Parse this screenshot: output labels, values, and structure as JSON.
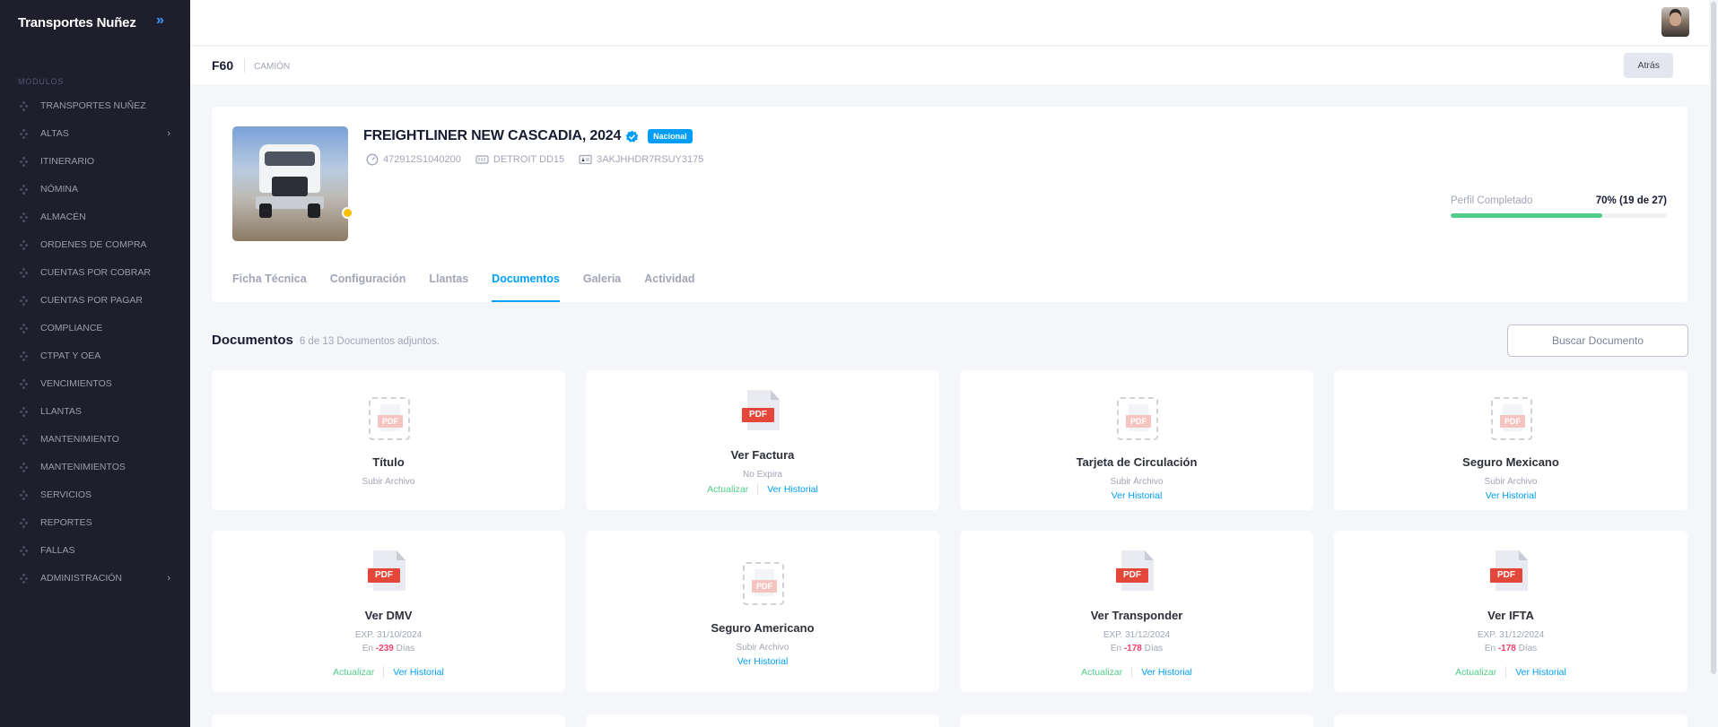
{
  "sidebar": {
    "brand": "Transportes Nuñez",
    "section_label": "MODULOS",
    "items": [
      {
        "label": "TRANSPORTES NUÑEZ",
        "has_arrow": false
      },
      {
        "label": "ALTAS",
        "has_arrow": true
      },
      {
        "label": "ITINERARIO",
        "has_arrow": false
      },
      {
        "label": "NÓMINA",
        "has_arrow": false
      },
      {
        "label": "ALMACÉN",
        "has_arrow": false
      },
      {
        "label": "ORDENES DE COMPRA",
        "has_arrow": false
      },
      {
        "label": "CUENTAS POR COBRAR",
        "has_arrow": false
      },
      {
        "label": "CUENTAS POR PAGAR",
        "has_arrow": false
      },
      {
        "label": "COMPLIANCE",
        "has_arrow": false
      },
      {
        "label": "CTPAT Y OEA",
        "has_arrow": false
      },
      {
        "label": "VENCIMIENTOS",
        "has_arrow": false
      },
      {
        "label": "LLANTAS",
        "has_arrow": false
      },
      {
        "label": "MANTENIMIENTO",
        "has_arrow": false
      },
      {
        "label": "MANTENIMIENTOS",
        "has_arrow": false
      },
      {
        "label": "SERVICIOS",
        "has_arrow": false
      },
      {
        "label": "REPORTES",
        "has_arrow": false
      },
      {
        "label": "FALLAS",
        "has_arrow": false
      },
      {
        "label": "ADMINISTRACIÓN",
        "has_arrow": true
      }
    ]
  },
  "subheader": {
    "title": "F60",
    "type": "CAMIÓN",
    "back_label": "Atrás"
  },
  "vehicle": {
    "title": "FREIGHTLINER NEW CASCADIA, 2024",
    "badge": "Nacional",
    "odometer": "472912S1040200",
    "engine": "DETROIT DD15",
    "vin": "3AKJHHDR7RSUY3175",
    "profile_label": "Perfil Completado",
    "profile_value": "70% (19 de 27)",
    "profile_fraction": 0.7
  },
  "tabs": [
    {
      "label": "Ficha Técnica",
      "active": false
    },
    {
      "label": "Configuración",
      "active": false
    },
    {
      "label": "Llantas",
      "active": false
    },
    {
      "label": "Documentos",
      "active": true
    },
    {
      "label": "Galeria",
      "active": false
    },
    {
      "label": "Actividad",
      "active": false
    }
  ],
  "documents": {
    "title": "Documentos",
    "summary": "6 de 13 Documentos adjuntos.",
    "search_label": "Buscar Documento",
    "cards": [
      {
        "name": "Título",
        "uploaded": false,
        "status": "Subir Archivo",
        "history": ""
      },
      {
        "name": "Ver Factura",
        "uploaded": true,
        "status": "No Expira",
        "update": "Actualizar",
        "history": "Ver Historial"
      },
      {
        "name": "Tarjeta de Circulación",
        "uploaded": false,
        "status": "Subir Archivo",
        "history": "Ver Historial"
      },
      {
        "name": "Seguro Mexicano",
        "uploaded": false,
        "status": "Subir Archivo",
        "history": "Ver Historial"
      },
      {
        "name": "Ver DMV",
        "uploaded": true,
        "exp": "EXP. 31/10/2024",
        "days_prefix": "En",
        "days": "-239",
        "days_suffix": "Días",
        "update": "Actualizar",
        "history": "Ver Historial"
      },
      {
        "name": "Seguro Americano",
        "uploaded": false,
        "status": "Subir Archivo",
        "history": "Ver Historial"
      },
      {
        "name": "Ver Transponder",
        "uploaded": true,
        "exp": "EXP. 31/12/2024",
        "days_prefix": "En",
        "days": "-178",
        "days_suffix": "Días",
        "update": "Actualizar",
        "history": "Ver Historial"
      },
      {
        "name": "Ver IFTA",
        "uploaded": true,
        "exp": "EXP. 31/12/2024",
        "days_prefix": "En",
        "days": "-178",
        "days_suffix": "Días",
        "update": "Actualizar",
        "history": "Ver Historial"
      }
    ]
  },
  "icons": {
    "brand_toggle": "double-chevron-right-icon",
    "verified": "verified-check-icon",
    "odometer": "speedometer-icon",
    "engine": "engine-icon",
    "vin": "vin-card-icon",
    "pdf": "pdf-file-icon",
    "pdf_placeholder": "pdf-placeholder-icon"
  },
  "colors": {
    "sidebar_bg": "#1e1e2d",
    "primary": "#009ef7",
    "success": "#50cd89",
    "danger": "#f1416c",
    "pdf_red": "#e4473a",
    "status_dot": "#f6c000"
  },
  "pdf_label": "PDF"
}
